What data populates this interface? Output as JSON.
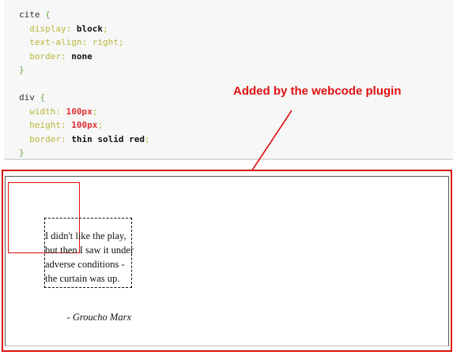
{
  "code": {
    "lines": [
      [
        {
          "t": "cite ",
          "c": "selector"
        },
        {
          "t": "{",
          "c": "brace"
        }
      ],
      [
        {
          "t": "  display",
          "c": "prop"
        },
        {
          "t": ": ",
          "c": "colon"
        },
        {
          "t": "block",
          "c": "val-kw"
        },
        {
          "t": ";",
          "c": "semi"
        }
      ],
      [
        {
          "t": "  text-align",
          "c": "prop"
        },
        {
          "t": ": ",
          "c": "colon"
        },
        {
          "t": "right",
          "c": "prop"
        },
        {
          "t": ";",
          "c": "semi"
        }
      ],
      [
        {
          "t": "  border",
          "c": "prop"
        },
        {
          "t": ": ",
          "c": "colon"
        },
        {
          "t": "none",
          "c": "val-kw"
        }
      ],
      [
        {
          "t": "}",
          "c": "brace"
        }
      ],
      [
        {
          "t": "",
          "c": "selector"
        }
      ],
      [
        {
          "t": "div ",
          "c": "selector"
        },
        {
          "t": "{",
          "c": "brace"
        }
      ],
      [
        {
          "t": "  width",
          "c": "prop"
        },
        {
          "t": ": ",
          "c": "colon"
        },
        {
          "t": "100px",
          "c": "val-num"
        },
        {
          "t": ";",
          "c": "semi"
        }
      ],
      [
        {
          "t": "  height",
          "c": "prop"
        },
        {
          "t": ": ",
          "c": "colon"
        },
        {
          "t": "100px",
          "c": "val-num"
        },
        {
          "t": ";",
          "c": "semi"
        }
      ],
      [
        {
          "t": "  border",
          "c": "prop"
        },
        {
          "t": ": ",
          "c": "colon"
        },
        {
          "t": "thin solid red",
          "c": "val-kw"
        },
        {
          "t": ";",
          "c": "semi"
        }
      ],
      [
        {
          "t": "}",
          "c": "brace"
        }
      ]
    ]
  },
  "annotation": {
    "text": "Added by the webcode plugin",
    "color": "#e01010"
  },
  "preview": {
    "quote": "I didn't like the play, but then I saw it under adverse conditions - the curtain was up.",
    "cite": "- Groucho Marx"
  }
}
